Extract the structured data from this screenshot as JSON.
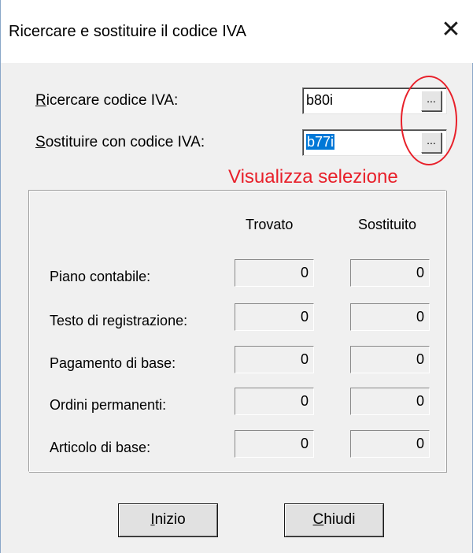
{
  "window": {
    "title": "Ricercare e sostituire il codice IVA",
    "close_glyph": "✕"
  },
  "search": {
    "label_accel": "R",
    "label_rest": "icercare codice IVA:",
    "value": "b80i",
    "browse_label": "..."
  },
  "replace": {
    "label_accel": "S",
    "label_rest": "ostituire con codice IVA:",
    "value": "b77i",
    "browse_label": "..."
  },
  "annotation": {
    "text": "Visualizza selezione",
    "color": "#e8202a"
  },
  "results": {
    "col_found": "Trovato",
    "col_replaced": "Sostituito",
    "rows": [
      {
        "label": "Piano contabile:",
        "found": "0",
        "replaced": "0"
      },
      {
        "label": "Testo di registrazione:",
        "found": "0",
        "replaced": "0"
      },
      {
        "label": "Pagamento di base:",
        "found": "0",
        "replaced": "0"
      },
      {
        "label": "Ordini permanenti:",
        "found": "0",
        "replaced": "0"
      },
      {
        "label": "Articolo di base:",
        "found": "0",
        "replaced": "0"
      }
    ]
  },
  "buttons": {
    "start_accel": "I",
    "start_rest": "nizio",
    "close_accel": "C",
    "close_rest": "hiudi"
  }
}
